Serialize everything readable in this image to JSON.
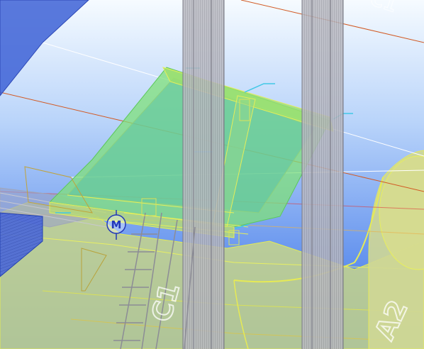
{
  "viewport": {
    "name": "3D model view",
    "background_top": "#f2f8fe",
    "background_bottom": "#3a74e8"
  },
  "model": {
    "platform_color": "#7fe07a",
    "edge_highlight_color": "#e6ef5a",
    "column_color": "#a9a9b0",
    "gridline_red": "#d25a24",
    "gridline_white": "#ffffff",
    "handle_marker_color": "#41c8e6",
    "ground_color": "#c9d690",
    "left_beam_color": "#3b56d0",
    "label_marks": [
      "C1",
      "A2"
    ]
  },
  "cursor": {
    "icon": "move-gizmo-icon",
    "letter": "M"
  }
}
